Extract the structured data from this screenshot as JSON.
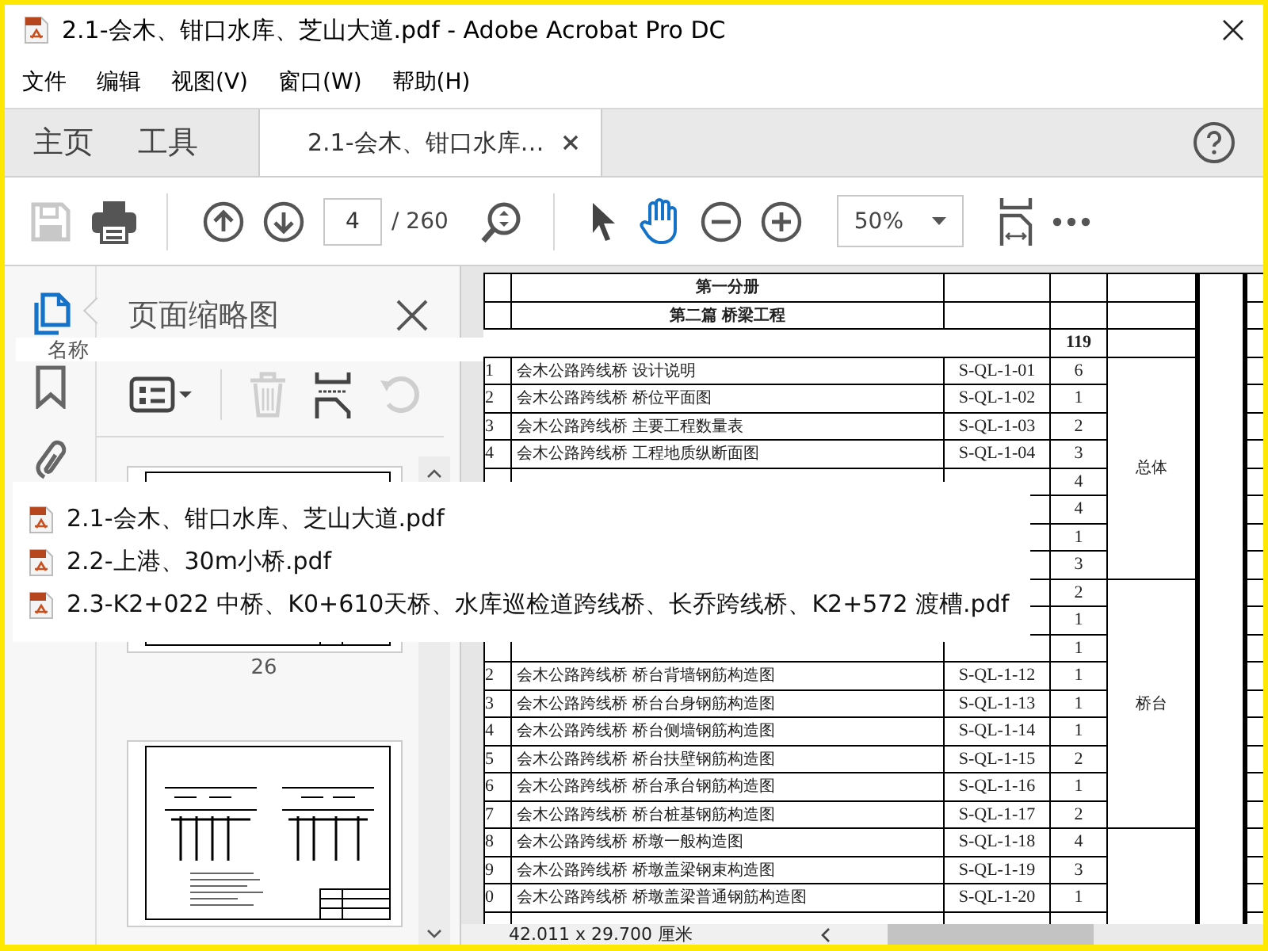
{
  "window": {
    "title": "2.1-会木、钳口水库、芝山大道.pdf - Adobe Acrobat Pro DC"
  },
  "menu": [
    "文件",
    "编辑",
    "视图(V)",
    "窗口(W)",
    "帮助(H)"
  ],
  "tabs": [
    {
      "label": "主页",
      "kind": "home",
      "selected": false
    },
    {
      "label": "工具",
      "kind": "home",
      "selected": false
    },
    {
      "label": "2.1-会木、钳口水库…",
      "kind": "document",
      "selected": true
    }
  ],
  "toolbar": {
    "save": {
      "disabled": true
    },
    "page_number": "4",
    "page_total": "/ 260",
    "select_tool": {
      "selected": false
    },
    "hand_tool": {
      "selected": true
    },
    "zoom": "50%"
  },
  "sidebar": {
    "items": [
      {
        "selected": true
      },
      {
        "selected": false
      },
      {
        "selected": false
      }
    ]
  },
  "thumbnails_panel": {
    "title": "页面缩略图",
    "delete": {
      "disabled": true
    },
    "rotate": {
      "disabled": true
    },
    "page_label": "26"
  },
  "name_tooltip": "名称",
  "recent_files": [
    "2.1-会木、钳口水库、芝山大道.pdf",
    "2.2-上港、30m小桥.pdf",
    "2.3-K2+022 中桥、K0+610天桥、水库巡检道跨线桥、长乔跨线桥、K2+572 渡槽.pdf"
  ],
  "document": {
    "table": {
      "headings": [
        "第一分册",
        "第二篇 桥梁工程"
      ],
      "total": "119",
      "groups": [
        {
          "label": "总体",
          "rows": [
            {
              "index": "1",
              "title": "会木公路跨线桥 设计说明",
              "code": "S-QL-1-01",
              "count": "6"
            },
            {
              "index": "2",
              "title": "会木公路跨线桥 桥位平面图",
              "code": "S-QL-1-02",
              "count": "1"
            },
            {
              "index": "3",
              "title": "会木公路跨线桥 主要工程数量表",
              "code": "S-QL-1-03",
              "count": "2"
            },
            {
              "index": "4",
              "title": "会木公路跨线桥 工程地质纵断面图",
              "code": "S-QL-1-04",
              "count": "3"
            },
            {
              "count": "4"
            },
            {
              "count": "4"
            },
            {
              "count": "1"
            },
            {
              "count": "3"
            }
          ]
        },
        {
          "label": "桥台",
          "rows": [
            {
              "count": "2"
            },
            {
              "count": "1"
            },
            {
              "count": "1"
            },
            {
              "index": "2",
              "title": "会木公路跨线桥 桥台背墙钢筋构造图",
              "code": "S-QL-1-12",
              "count": "1"
            },
            {
              "index": "3",
              "title": "会木公路跨线桥 桥台台身钢筋构造图",
              "code": "S-QL-1-13",
              "count": "1"
            },
            {
              "index": "4",
              "title": "会木公路跨线桥 桥台侧墙钢筋构造图",
              "code": "S-QL-1-14",
              "count": "1"
            },
            {
              "index": "5",
              "title": "会木公路跨线桥 桥台扶壁钢筋构造图",
              "code": "S-QL-1-15",
              "count": "2"
            },
            {
              "index": "6",
              "title": "会木公路跨线桥 桥台承台钢筋构造图",
              "code": "S-QL-1-16",
              "count": "1"
            },
            {
              "index": "7",
              "title": "会木公路跨线桥 桥台桩基钢筋构造图",
              "code": "S-QL-1-17",
              "count": "2"
            }
          ]
        },
        {
          "rows": [
            {
              "index": "8",
              "title": "会木公路跨线桥 桥墩一般构造图",
              "code": "S-QL-1-18",
              "count": "4"
            },
            {
              "index": "9",
              "title": "会木公路跨线桥 桥墩盖梁钢束构造图",
              "code": "S-QL-1-19",
              "count": "3"
            },
            {
              "index": "0",
              "title": "会木公路跨线桥 桥墩盖梁普通钢筋构造图",
              "code": "S-QL-1-20",
              "count": "1"
            }
          ]
        }
      ]
    }
  },
  "status_bar": {
    "page_size": "42.011 x 29.700 厘米"
  }
}
